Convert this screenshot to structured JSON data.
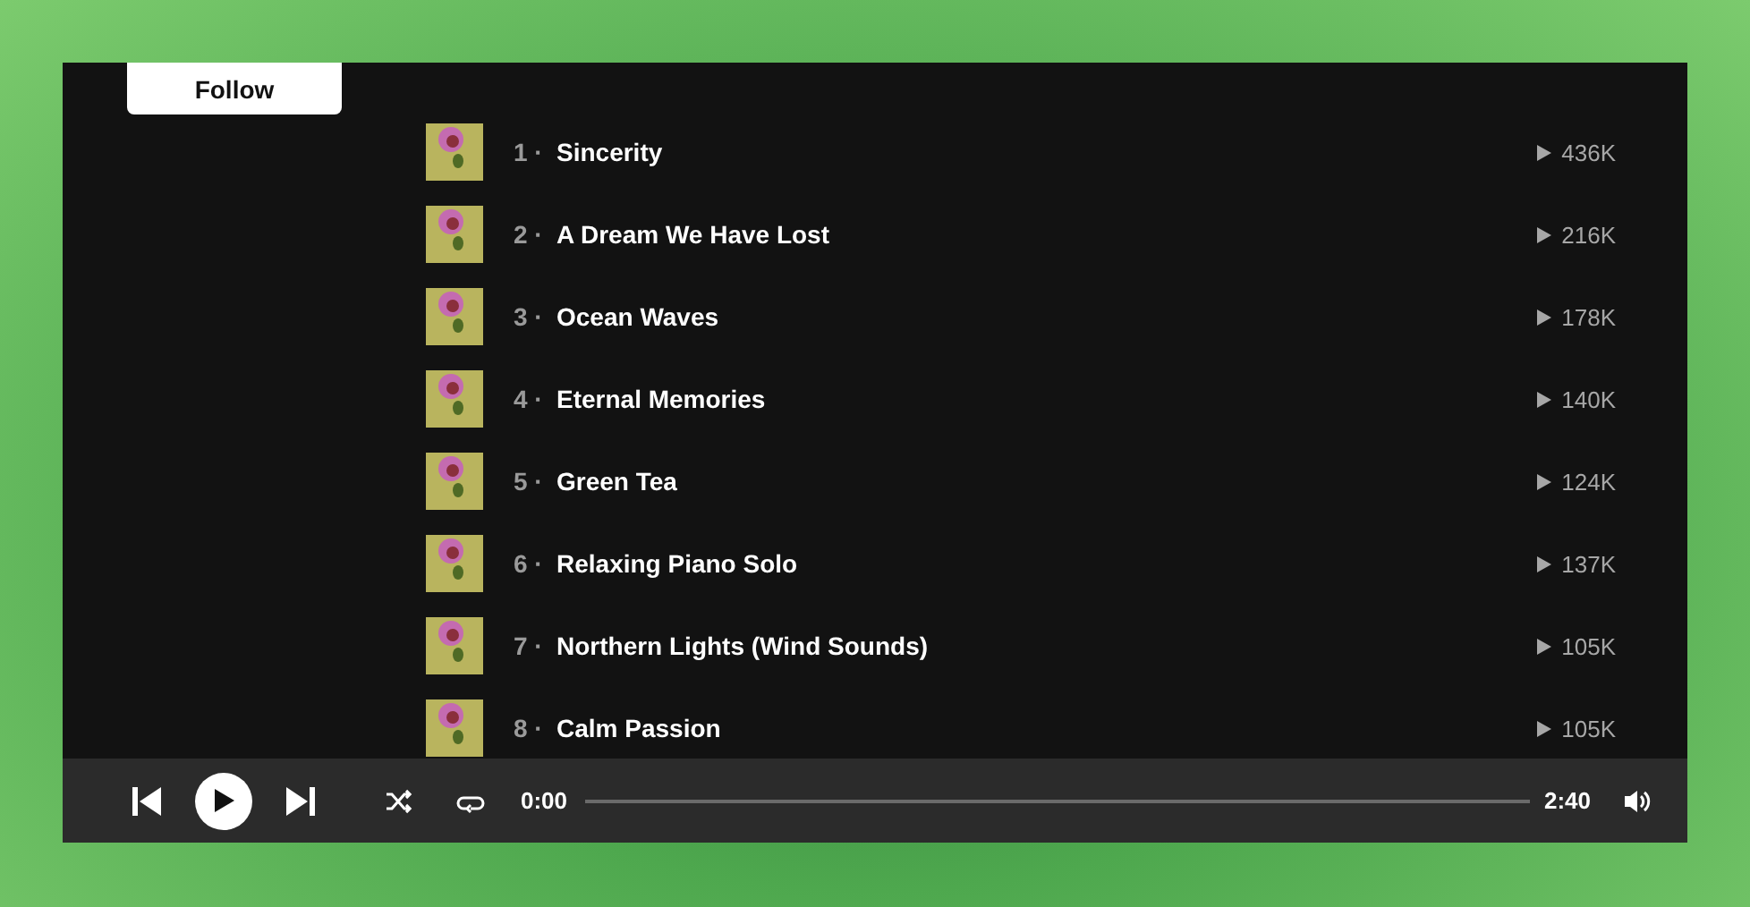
{
  "follow_button": {
    "label": "Follow"
  },
  "tracks": [
    {
      "number": "1 ·",
      "title": "Sincerity",
      "plays": "436K"
    },
    {
      "number": "2 ·",
      "title": "A Dream We Have Lost",
      "plays": "216K"
    },
    {
      "number": "3 ·",
      "title": "Ocean Waves",
      "plays": "178K"
    },
    {
      "number": "4 ·",
      "title": "Eternal Memories",
      "plays": "140K"
    },
    {
      "number": "5 ·",
      "title": "Green Tea",
      "plays": "124K"
    },
    {
      "number": "6 ·",
      "title": "Relaxing Piano Solo",
      "plays": "137K"
    },
    {
      "number": "7 ·",
      "title": "Northern Lights (Wind Sounds)",
      "plays": "105K"
    },
    {
      "number": "8 ·",
      "title": "Calm Passion",
      "plays": "105K"
    }
  ],
  "player": {
    "elapsed": "0:00",
    "duration": "2:40"
  }
}
